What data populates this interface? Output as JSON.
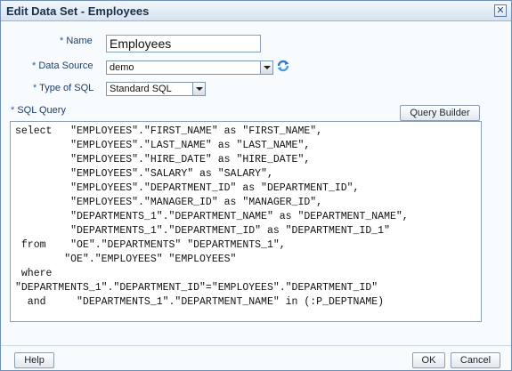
{
  "dialog": {
    "title": "Edit Data Set - Employees",
    "close_icon": "close-icon"
  },
  "form": {
    "required_mark": "*",
    "name_label": "Name",
    "name_value": "Employees",
    "data_source_label": "Data Source",
    "data_source_value": "demo",
    "refresh_icon": "refresh-icon",
    "type_label": "Type of SQL",
    "type_value": "Standard SQL",
    "sql_label": "SQL Query",
    "query_builder_label": "Query Builder",
    "sql_text": "select   \"EMPLOYEES\".\"FIRST_NAME\" as \"FIRST_NAME\",\n         \"EMPLOYEES\".\"LAST_NAME\" as \"LAST_NAME\",\n         \"EMPLOYEES\".\"HIRE_DATE\" as \"HIRE_DATE\",\n         \"EMPLOYEES\".\"SALARY\" as \"SALARY\",\n         \"EMPLOYEES\".\"DEPARTMENT_ID\" as \"DEPARTMENT_ID\",\n         \"EMPLOYEES\".\"MANAGER_ID\" as \"MANAGER_ID\",\n         \"DEPARTMENTS_1\".\"DEPARTMENT_NAME\" as \"DEPARTMENT_NAME\",\n         \"DEPARTMENTS_1\".\"DEPARTMENT_ID\" as \"DEPARTMENT_ID_1\"\n from    \"OE\".\"DEPARTMENTS\" \"DEPARTMENTS_1\",\n        \"OE\".\"EMPLOYEES\" \"EMPLOYEES\"\n where\n\"DEPARTMENTS_1\".\"DEPARTMENT_ID\"=\"EMPLOYEES\".\"DEPARTMENT_ID\"\n  and     \"DEPARTMENTS_1\".\"DEPARTMENT_NAME\" in (:P_DEPTNAME)"
  },
  "footer": {
    "help_label": "Help",
    "ok_label": "OK",
    "cancel_label": "Cancel"
  },
  "colors": {
    "label": "#1c3e69",
    "title_bar": "#d5e3f1",
    "border": "#6f8fb5"
  }
}
